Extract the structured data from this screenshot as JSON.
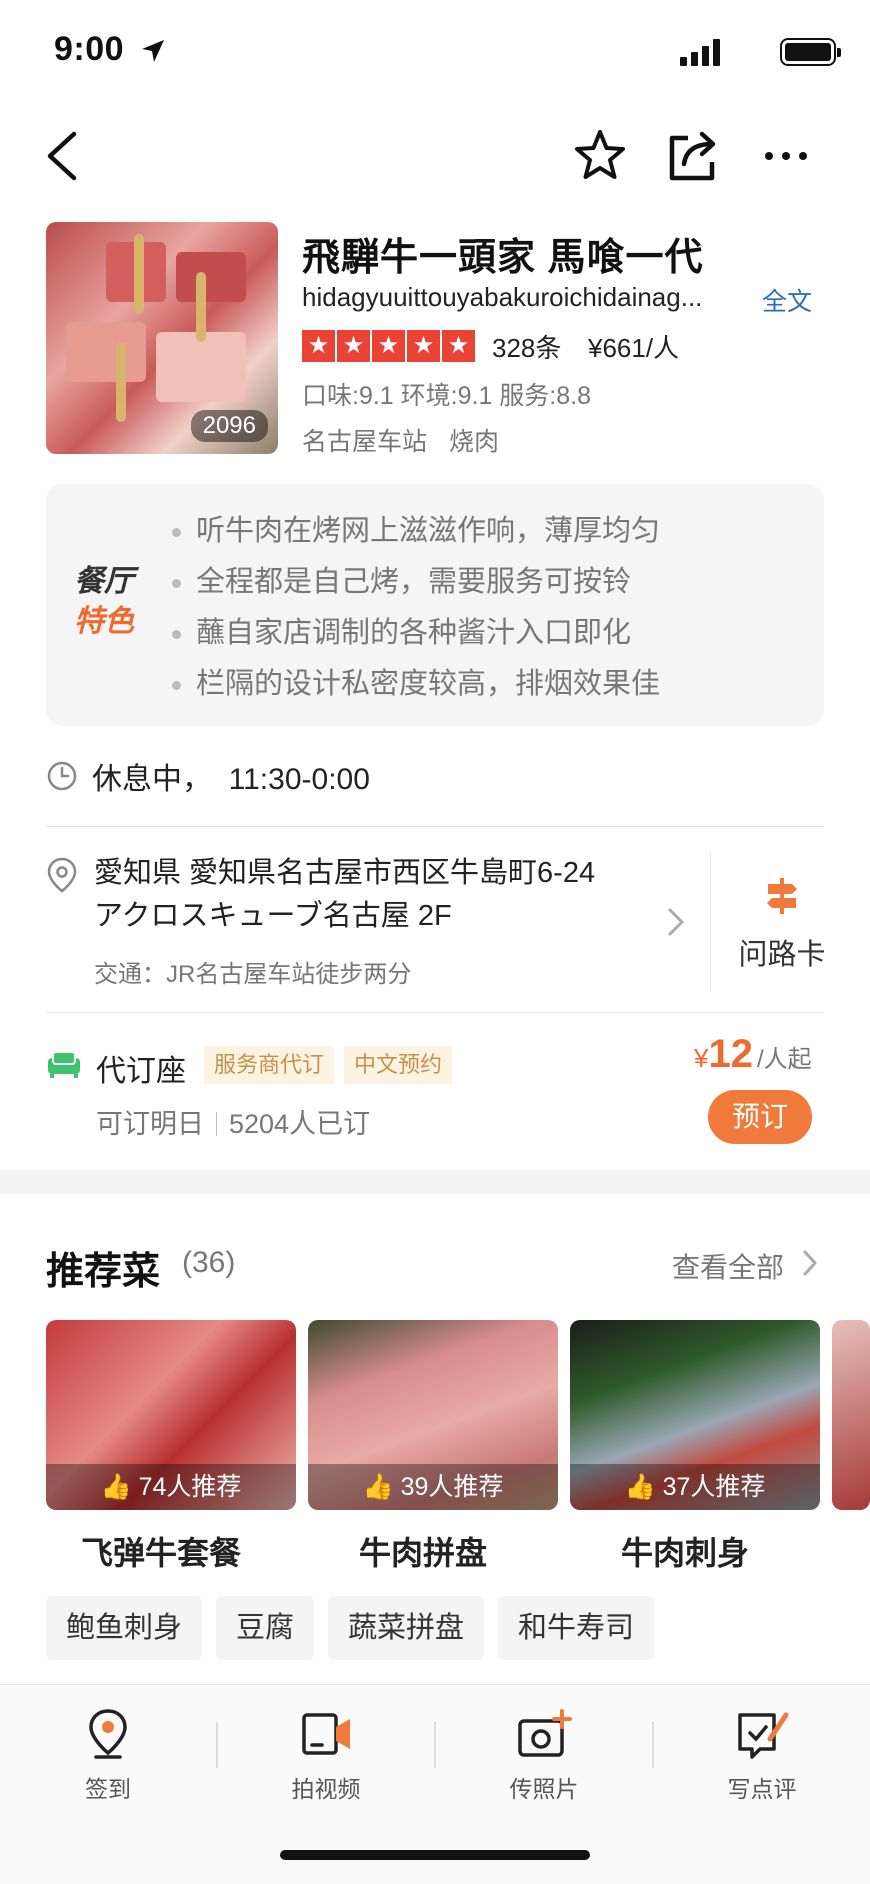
{
  "status": {
    "time": "9:00"
  },
  "nav": {
    "back": "back-icon",
    "favorite": "star-icon",
    "share": "share-icon",
    "more": "more-icon"
  },
  "restaurant": {
    "photo_count": "2096",
    "name": "飛騨牛一頭家 馬喰一代",
    "subtitle": "hidagyuuittouyabakuroichidainag...",
    "fulltext_link": "全文",
    "rating_stars": 5,
    "reviews": "328条",
    "price": "¥661/人",
    "scores": "口味:9.1 环境:9.1 服务:8.8",
    "tags": [
      "名古屋车站",
      "烧肉"
    ]
  },
  "features": {
    "label_line1": "餐厅",
    "label_line2": "特色",
    "items": [
      "听牛肉在烤网上滋滋作响，薄厚均匀",
      "全程都是自己烤，需要服务可按铃",
      "蘸自家店调制的各种酱汁入口即化",
      "栏隔的设计私密度较高，排烟效果佳"
    ]
  },
  "hours": {
    "text": "休息中，  11:30-0:00"
  },
  "address": {
    "line1": "愛知県 愛知県名古屋市西区牛島町6-24",
    "line2": "アクロスキューブ名古屋 2F",
    "transit": "交通：JR名古屋车站徒步两分",
    "route_card": "问路卡"
  },
  "booking": {
    "title": "代订座",
    "badges": [
      "服务商代订",
      "中文预约"
    ],
    "availability": "可订明日",
    "booked": "5204人已订",
    "currency": "¥",
    "price": "12",
    "unit": "/人起",
    "button": "预订",
    "accent": "#ee6a2f"
  },
  "recommended": {
    "title": "推荐菜",
    "count": "(36)",
    "view_all": "查看全部",
    "dishes": [
      {
        "name": "飞弹牛套餐",
        "recommend": "74人推荐"
      },
      {
        "name": "牛肉拼盘",
        "recommend": "39人推荐"
      },
      {
        "name": "牛肉刺身",
        "recommend": "37人推荐"
      }
    ],
    "chips": [
      "鲍鱼刺身",
      "豆腐",
      "蔬菜拼盘",
      "和牛寿司"
    ]
  },
  "tabbar": {
    "items": [
      {
        "label": "签到",
        "icon": "checkin-pin-icon"
      },
      {
        "label": "拍视频",
        "icon": "video-icon"
      },
      {
        "label": "传照片",
        "icon": "photo-upload-icon"
      },
      {
        "label": "写点评",
        "icon": "write-review-icon"
      }
    ]
  }
}
